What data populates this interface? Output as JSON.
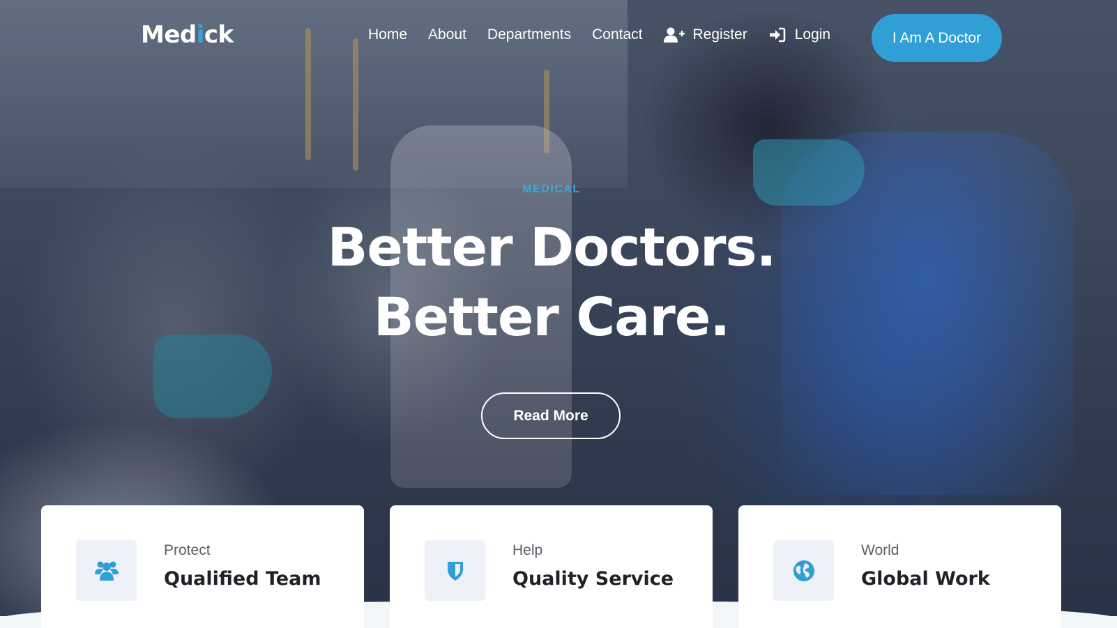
{
  "brand": {
    "logo_prefix": "Med",
    "logo_accent": "i",
    "logo_suffix": "ck",
    "accent_color": "#2fa6df"
  },
  "nav": {
    "home": "Home",
    "about": "About",
    "departments": "Departments",
    "contact": "Contact",
    "register": "Register",
    "login": "Login",
    "cta": "I Am A Doctor"
  },
  "icons": {
    "register": "user-plus-icon",
    "login": "sign-in-icon",
    "team": "users-icon",
    "service": "shield-icon",
    "world": "globe-icon"
  },
  "hero": {
    "eyebrow": "MEDICAL",
    "headline_line1": "Better Doctors.",
    "headline_line2": "Better Care.",
    "button": "Read More"
  },
  "features": [
    {
      "kicker": "Protect",
      "title": "Qualified Team"
    },
    {
      "kicker": "Help",
      "title": "Quality Service"
    },
    {
      "kicker": "World",
      "title": "Global Work"
    }
  ],
  "colors": {
    "primary": "#2f9fd6",
    "eyebrow": "#39a9e2",
    "card_bg": "#ffffff",
    "icon_bg": "#eef2f8"
  }
}
